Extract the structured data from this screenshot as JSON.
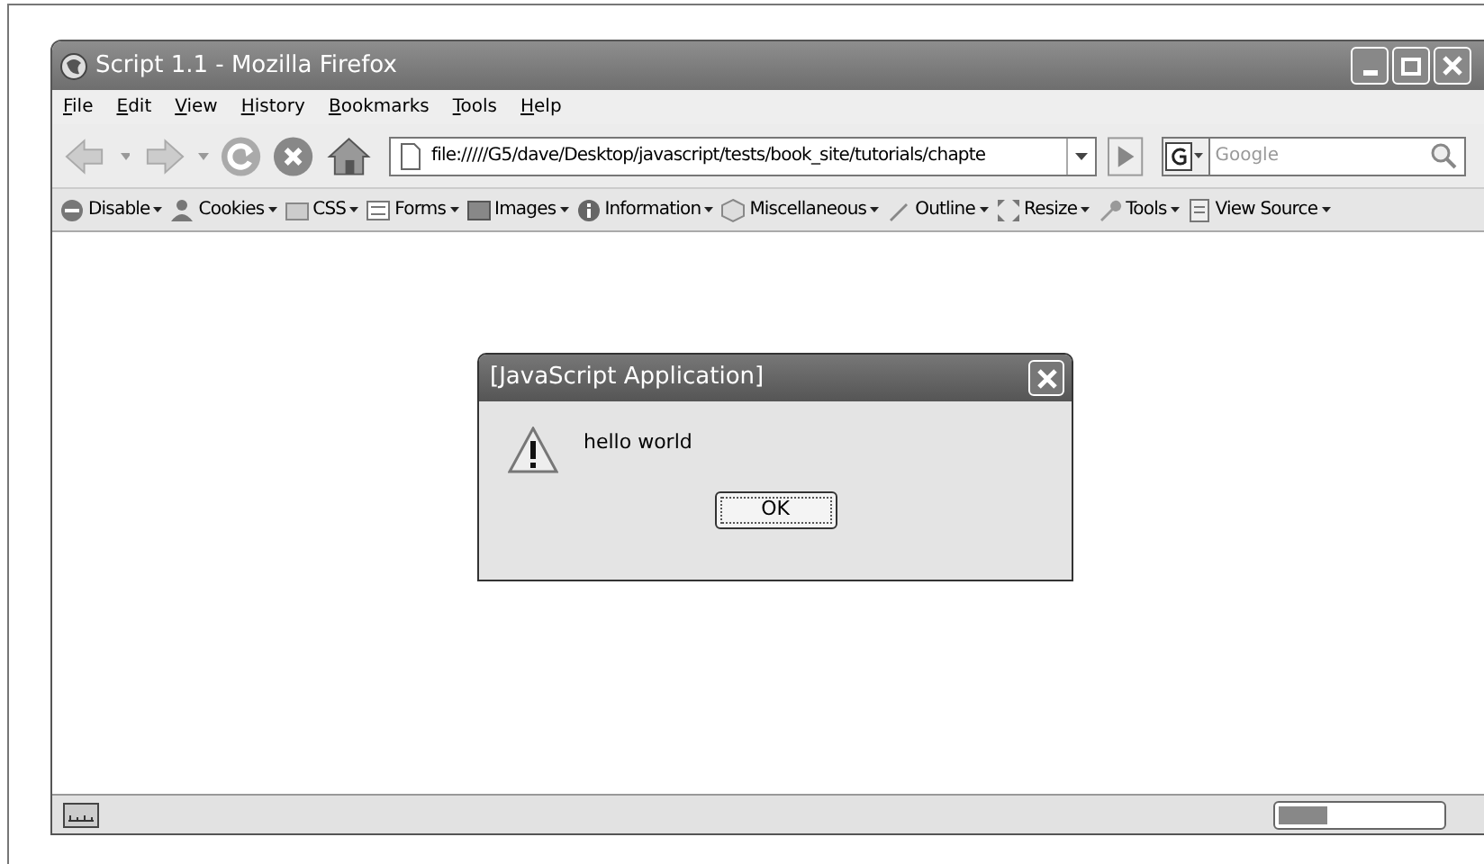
{
  "window": {
    "title": "Script 1.1 - Mozilla Firefox"
  },
  "menu": [
    "File",
    "Edit",
    "View",
    "History",
    "Bookmarks",
    "Tools",
    "Help"
  ],
  "navigation": {
    "url": "file://///G5/dave/Desktop/javascript/tests/book_site/tutorials/chapte",
    "search_placeholder": "Google"
  },
  "toolbar": [
    "Disable",
    "Cookies",
    "CSS",
    "Forms",
    "Images",
    "Information",
    "Miscellaneous",
    "Outline",
    "Resize",
    "Tools",
    "View Source"
  ],
  "dialog": {
    "title": "[JavaScript Application]",
    "message": "hello world",
    "button": "OK"
  },
  "status_bar": {
    "progress": {
      "level": 0.3
    }
  }
}
